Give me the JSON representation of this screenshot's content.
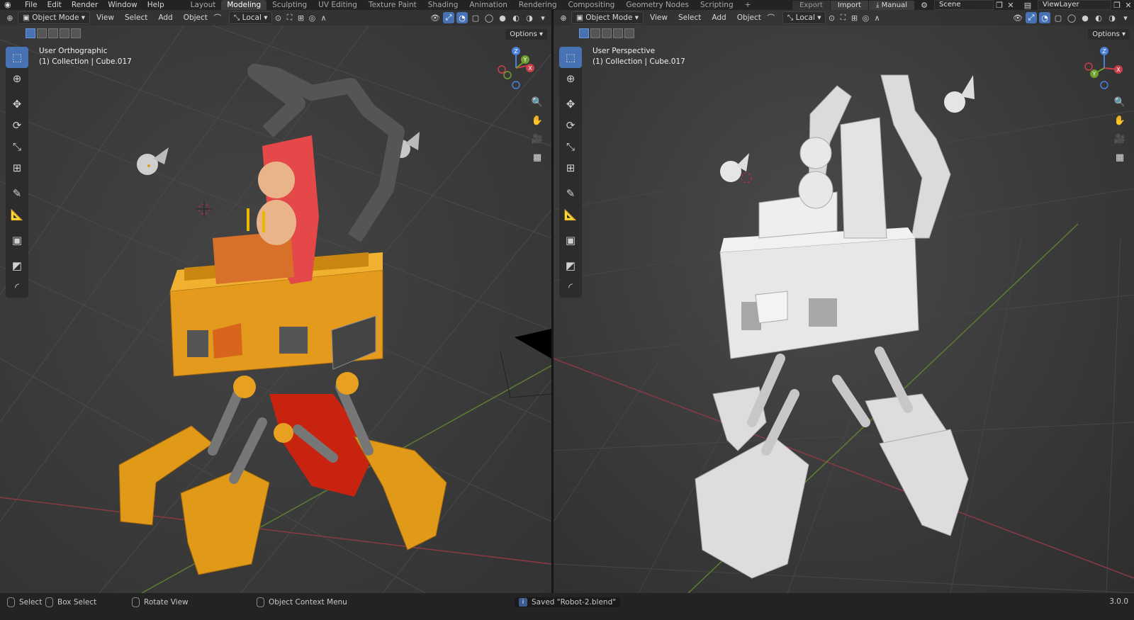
{
  "menu": {
    "file": "File",
    "edit": "Edit",
    "render": "Render",
    "window": "Window",
    "help": "Help"
  },
  "workspaces": [
    "Layout",
    "Modeling",
    "Sculpting",
    "UV Editing",
    "Texture Paint",
    "Shading",
    "Animation",
    "Rendering",
    "Compositing",
    "Geometry Nodes",
    "Scripting"
  ],
  "active_workspace": "Modeling",
  "topbar_right": {
    "export": "Export",
    "import": "Import",
    "manual": "Manual",
    "scene": "Scene",
    "view_layer": "ViewLayer"
  },
  "viewport_left": {
    "mode": "Object Mode",
    "view": "View",
    "select": "Select",
    "add": "Add",
    "object": "Object",
    "transform_orientation": "Local",
    "options": "Options",
    "view_name": "User Orthographic",
    "collection_info": "(1) Collection | Cube.017"
  },
  "viewport_right": {
    "mode": "Object Mode",
    "view": "View",
    "select": "Select",
    "add": "Add",
    "object": "Object",
    "transform_orientation": "Local",
    "options": "Options",
    "view_name": "User Perspective",
    "collection_info": "(1) Collection | Cube.017"
  },
  "gizmo_axes": {
    "x": "X",
    "y": "Y",
    "z": "Z"
  },
  "statusbar": {
    "select": "Select",
    "box_select": "Box Select",
    "rotate_view": "Rotate View",
    "context_menu": "Object Context Menu",
    "saved_message": "Saved \"Robot-2.blend\"",
    "version": "3.0.0"
  },
  "colors": {
    "accent": "#4772b3",
    "robot_orange": "#e8a020",
    "seat_red": "#e03a3a",
    "clay": "#dcdadc",
    "x_axis": "#b84450",
    "y_axis": "#6a9a3a"
  }
}
